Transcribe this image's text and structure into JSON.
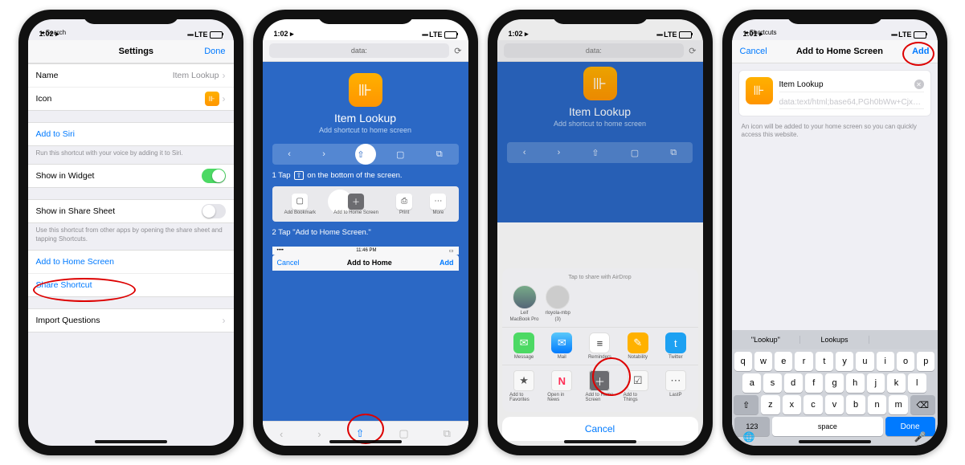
{
  "status": {
    "time1": "1:02 ▸",
    "time2": "1:02 ▸",
    "time3": "1:02 ▸",
    "time4": "1:01 ▸",
    "back1": "◂ Search",
    "back4": "◂ Shortcuts",
    "carrier": "LTE",
    "signal": "▪▪▪▪"
  },
  "p1": {
    "title": "Settings",
    "done": "Done",
    "name_label": "Name",
    "name_value": "Item Lookup",
    "icon_label": "Icon",
    "siri": "Add to Siri",
    "siri_hint": "Run this shortcut with your voice by adding it to Siri.",
    "widget": "Show in Widget",
    "sharesheet": "Show in Share Sheet",
    "sharesheet_hint": "Use this shortcut from other apps by opening the share sheet and tapping Shortcuts.",
    "addhome": "Add to Home Screen",
    "shareshortcut": "Share Shortcut",
    "import": "Import Questions"
  },
  "p2": {
    "url": "data:",
    "reload": "⟳",
    "title": "Item Lookup",
    "sub": "Add shortcut to home screen",
    "step1_pre": "1  Tap",
    "step1_post": "on the bottom of the screen.",
    "step2": "2  Tap \"Add to Home Screen.\"",
    "actions": [
      "Add Bookmark",
      "Add to Home Screen",
      "Print",
      "More"
    ],
    "mini_time": "11:46 PM",
    "mini_cancel": "Cancel",
    "mini_title": "Add to Home",
    "mini_add": "Add"
  },
  "p3": {
    "airdrop_label": "Tap to share with AirDrop",
    "people": [
      {
        "name": "Leif",
        "device": "MacBook Pro"
      },
      {
        "name": "rloyola-mbp",
        "device": "(3)"
      }
    ],
    "apps": [
      {
        "name": "Message",
        "color": "#4cd964",
        "glyph": "✉"
      },
      {
        "name": "Mail",
        "color": "#1f80ff",
        "glyph": "✉"
      },
      {
        "name": "Reminders",
        "color": "#fff",
        "glyph": "≡"
      },
      {
        "name": "Notability",
        "color": "#ffb100",
        "glyph": "✎"
      },
      {
        "name": "Twitter",
        "color": "#1da1f2",
        "glyph": "🐦"
      }
    ],
    "exts": [
      {
        "name": "Add to Favorites",
        "glyph": "★"
      },
      {
        "name": "Open in News",
        "glyph": "N"
      },
      {
        "name": "Add to Home Screen",
        "glyph": "＋"
      },
      {
        "name": "Add to Things",
        "glyph": "☑"
      },
      {
        "name": "LastP",
        "glyph": "⋯"
      }
    ],
    "cancel": "Cancel"
  },
  "p4": {
    "cancel": "Cancel",
    "title": "Add to Home Screen",
    "add": "Add",
    "name_value": "Item Lookup",
    "url_value": "data:text/html;base64,PGh0bWw+Cjx…",
    "hint": "An icon will be added to your home screen so you can quickly access this website.",
    "sugg1": "\"Lookup\"",
    "sugg2": "Lookups",
    "keys_r1": [
      "q",
      "w",
      "e",
      "r",
      "t",
      "y",
      "u",
      "i",
      "o",
      "p"
    ],
    "keys_r2": [
      "a",
      "s",
      "d",
      "f",
      "g",
      "h",
      "j",
      "k",
      "l"
    ],
    "keys_r3": [
      "z",
      "x",
      "c",
      "v",
      "b",
      "n",
      "m"
    ],
    "shift": "⇧",
    "bksp": "⌫",
    "num": "123",
    "space": "space",
    "done": "Done"
  }
}
